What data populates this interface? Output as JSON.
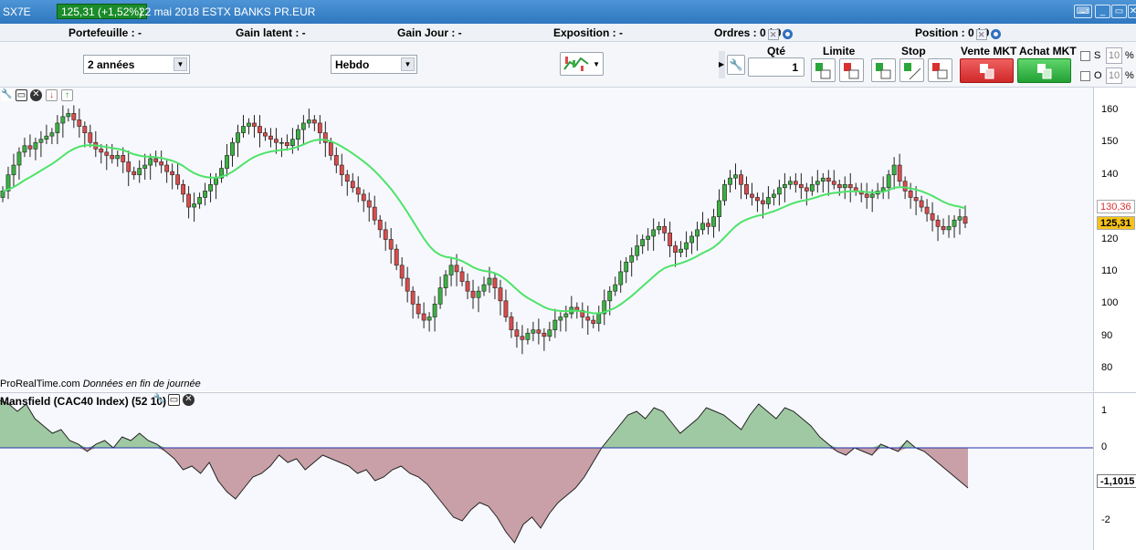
{
  "titlebar": {
    "symbol": "SX7E",
    "price_badge": "125,31 (+1,52%)",
    "date_name": "22 mai 2018 ESTX BANKS PR.EUR"
  },
  "infobar": {
    "portefeuille": "Portefeuille : -",
    "gain_latent": "Gain latent : -",
    "gain_jour": "Gain Jour : -",
    "exposition": "Exposition : -",
    "ordres": "Ordres : 0",
    "ordres2": "/ 0",
    "position": "Position : 0",
    "position2": "/ 0"
  },
  "toolbar": {
    "period": "2 années",
    "interval": "Hebdo",
    "qte_label": "Qté",
    "qte_value": "1",
    "limite_label": "Limite",
    "stop_label": "Stop",
    "vente_label": "Vente MKT",
    "achat_label": "Achat MKT",
    "s_label": "S",
    "o_label": "O",
    "s_pct": "10",
    "o_pct": "10",
    "pct_sign": "%"
  },
  "main": {
    "credit": "ProRealTime.com",
    "credit_note": "Données en fin de journée",
    "last_price": "125,31",
    "ma_value": "130,36"
  },
  "indicator": {
    "title": "Mansfield (CAC40 Index) (52 10)",
    "value": "-1,1015"
  },
  "colors": {
    "up": "#3cb043",
    "down": "#d94c4c",
    "ma_red": "#ff2020",
    "ma_green": "#4ee36a",
    "ind_pos": "#9fc9a2",
    "ind_neg": "#c9a0a7"
  },
  "chart_data": [
    {
      "type": "candlestick",
      "title": "SX7E Hebdo",
      "ylim": [
        73,
        167
      ],
      "yticks": [
        80,
        90,
        100,
        110,
        120,
        130,
        140,
        150,
        160
      ],
      "series": [
        {
          "name": "close",
          "values": [
            135,
            140,
            143,
            147,
            149,
            148,
            150,
            151,
            152,
            153,
            156,
            158,
            159,
            157,
            155,
            153,
            150,
            148,
            147,
            146,
            145,
            146,
            144,
            141,
            140,
            142,
            143,
            145,
            144,
            143,
            141,
            140,
            137,
            134,
            130,
            131,
            133,
            135,
            137,
            139,
            142,
            146,
            150,
            153,
            155,
            156,
            155,
            153,
            152,
            151,
            150,
            150,
            149,
            151,
            154,
            156,
            157,
            156,
            153,
            150,
            146,
            143,
            140,
            138,
            136,
            134,
            132,
            130,
            126,
            123,
            120,
            117,
            112,
            108,
            104,
            100,
            97,
            95,
            96,
            100,
            105,
            109,
            112,
            110,
            107,
            104,
            102,
            104,
            106,
            108,
            105,
            101,
            96,
            92,
            90,
            89,
            91,
            92,
            91,
            90,
            92,
            95,
            96,
            97,
            99,
            98,
            96,
            95,
            94,
            97,
            101,
            104,
            106,
            110,
            113,
            115,
            118,
            120,
            121,
            123,
            124,
            122,
            118,
            116,
            117,
            119,
            121,
            123,
            125,
            124,
            127,
            132,
            137,
            139,
            140,
            137,
            134,
            133,
            132,
            131,
            133,
            134,
            136,
            137,
            138,
            137,
            136,
            135,
            137,
            138,
            139,
            138,
            137,
            136,
            137,
            136,
            135,
            134,
            133,
            134,
            135,
            136,
            140,
            143,
            138,
            135,
            133,
            132,
            130,
            128,
            126,
            124,
            123,
            124,
            126,
            127,
            125
          ]
        }
      ]
    },
    {
      "type": "line",
      "title": "Mansfield (CAC40 Index) (52 10)",
      "ylim": [
        -2.6,
        1.3
      ],
      "yticks": [
        1,
        0,
        -2
      ],
      "values": [
        1.3,
        1.2,
        1.0,
        1.2,
        0.8,
        0.6,
        0.4,
        0.5,
        0.2,
        0.1,
        -0.1,
        0.1,
        0.2,
        0.0,
        0.3,
        0.2,
        0.4,
        0.2,
        0.1,
        -0.1,
        -0.3,
        -0.6,
        -0.5,
        -0.7,
        -0.4,
        -0.9,
        -1.2,
        -1.4,
        -1.1,
        -0.8,
        -0.7,
        -0.5,
        -0.2,
        -0.4,
        -0.3,
        -0.6,
        -0.4,
        -0.2,
        -0.3,
        -0.4,
        -0.5,
        -0.7,
        -0.6,
        -0.9,
        -0.8,
        -0.6,
        -0.5,
        -0.7,
        -0.8,
        -1.0,
        -1.3,
        -1.6,
        -1.9,
        -2.0,
        -1.7,
        -1.5,
        -1.6,
        -1.9,
        -2.3,
        -2.6,
        -2.1,
        -1.9,
        -2.2,
        -1.8,
        -1.5,
        -1.3,
        -1.1,
        -0.8,
        -0.4,
        0.0,
        0.3,
        0.6,
        0.9,
        1.0,
        0.8,
        1.1,
        1.0,
        0.7,
        0.4,
        0.6,
        0.8,
        1.1,
        1.0,
        0.9,
        0.7,
        0.5,
        0.9,
        1.2,
        1.0,
        0.8,
        1.1,
        1.0,
        0.8,
        0.6,
        0.3,
        0.1,
        -0.1,
        -0.2,
        0.0,
        -0.1,
        -0.2,
        0.1,
        0.0,
        -0.1,
        0.2,
        0.0,
        -0.1,
        -0.3,
        -0.5,
        -0.7,
        -0.9,
        -1.1
      ]
    }
  ]
}
